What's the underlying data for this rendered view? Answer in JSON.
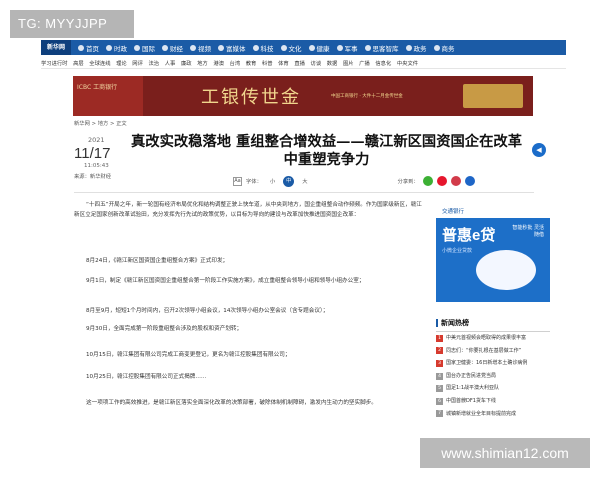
{
  "tag_overlay": "TG: MYYJJPP",
  "watermark": "www.shimian12.com",
  "nav": {
    "logo": "新华网",
    "items": [
      {
        "label": "首页",
        "icon": "home-icon"
      },
      {
        "label": "时政",
        "icon": "politics-icon"
      },
      {
        "label": "国际",
        "icon": "globe-icon"
      },
      {
        "label": "财经",
        "icon": "finance-icon"
      },
      {
        "label": "视频",
        "icon": "video-icon"
      },
      {
        "label": "富媒体",
        "icon": "media-icon"
      },
      {
        "label": "科技",
        "icon": "tech-icon"
      },
      {
        "label": "文化",
        "icon": "culture-icon"
      },
      {
        "label": "健康",
        "icon": "health-icon"
      },
      {
        "label": "军事",
        "icon": "military-icon"
      },
      {
        "label": "思客智库",
        "icon": "thinktank-icon"
      },
      {
        "label": "政务",
        "icon": "gov-icon"
      },
      {
        "label": "商务",
        "icon": "business-icon"
      }
    ]
  },
  "subnav": [
    "学习进行时",
    "高层",
    "全球连线",
    "理论",
    "网评",
    "法治",
    "人事",
    "廉政",
    "地方",
    "港澳",
    "台湾",
    "教育",
    "科普",
    "体育",
    "直播",
    "访谈",
    "数据",
    "图片",
    "广播",
    "信息化",
    "中央文件"
  ],
  "banner": {
    "left": "ICBC 工商银行",
    "title": "工银传世金",
    "sub": "中国工商银行 · 大件十二月金传世金"
  },
  "breadcrumb": "新华网 > 地方 > 正文",
  "meta": {
    "year": "2021",
    "monthday": "11/17",
    "time": "11:05:43",
    "source": "来源：新华财经"
  },
  "title_line1": "真改实改稳落地 重组整合增效益——赣江新区国资国企在改革",
  "title_line2": "中重塑竞争力",
  "toolbar": {
    "aa": "Aa",
    "font_label": "字体：",
    "small": "小",
    "medium": "中",
    "large": "大",
    "share_label": "分享到："
  },
  "paragraphs": [
    "“十四五”开局之年，新一轮国有经济布局优化和结构调整正驶上快车道，从中央到地方，国企重组整合动作频频。作为国家级新区，赣江新区立足国家创新改革试验田，充分发挥先行先试的政策优势，以目标为导向的建设与改革加快推进国资国企改革：",
    "8月24日，《赣江新区国资国企重组整合方案》正式印发；",
    "9月1日，制定《赣江新区国资国企重组整合第一阶段工作实施方案》，成立重组整合领导小组和领导小组办公室；",
    "8月至9月，短短1个月时间内，召开2次领导小组会议，14次领导小组办公室会议（含专题会议）；",
    "9月30日，全面完成第一阶段重组整合涉及的股权和资产划转；",
    "10月15日，赣江集团有限公司完成工商变更登记，更名为赣江控股集团有限公司；",
    "10月25日，赣江控股集团有限公司正式揭牌……",
    "这一项项工作的高效推进，是赣江新区落实全面深化改革的决策部署，破除体制机制障碍，激发内生动力的坚实脚步。"
  ],
  "ad": {
    "bank": "交通银行",
    "product": "普惠e贷",
    "tagline": "小微企业贷款",
    "slogan": "智能秒批 灵活随借"
  },
  "hot": {
    "heading": "新闻热榜",
    "items": [
      "中美元首视频会晤取得的成果很丰富",
      "同志们：“你要扎根在基层做工作”",
      "国家卫健委：16日新增本土确诊病例",
      "国台办正告民进党当局",
      "国足1:1战平澳大利亚队",
      "中国首艘DF1货车下线",
      "城镇新增就业全年目标提前完成"
    ]
  },
  "colors": {
    "nav_blue": "#1b5ba6",
    "banner_red": "#7a1f1c",
    "rank_red": "#d63a2e"
  }
}
